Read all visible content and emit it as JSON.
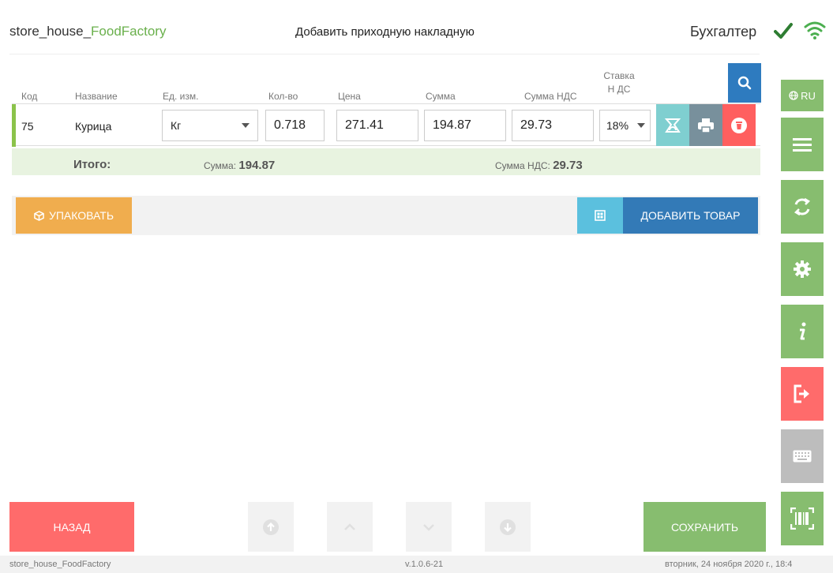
{
  "header": {
    "brand_prefix": "store_house_",
    "brand_accent": "FoodFactory",
    "title": "Добавить приходную накладную",
    "user": "Бухгалтер"
  },
  "table": {
    "columns": [
      "Код",
      "Название",
      "Ед. изм.",
      "Кол-во",
      "Цена",
      "Сумма",
      "Сумма НДС",
      "Ставка НДС"
    ],
    "vat_rate_header": "Ставка Н ДС",
    "rows": [
      {
        "code": "75",
        "name": "Курица",
        "unit": "Кг",
        "qty": "0.718",
        "price": "271.41",
        "sum": "194.87",
        "vat_sum": "29.73",
        "vat_rate": "18%"
      }
    ]
  },
  "totals": {
    "label": "Итого:",
    "sum_label": "Сумма:",
    "sum_value": "194.87",
    "vat_label": "Сумма НДС:",
    "vat_value": "29.73"
  },
  "actions": {
    "pack": "УПАКОВАТЬ",
    "add_item": "ДОБАВИТЬ ТОВАР"
  },
  "sidebar": {
    "lang": "RU",
    "items": [
      "menu-icon",
      "sync-icon",
      "gear-icon",
      "info-icon",
      "logout-icon",
      "keyboard-icon",
      "barcode-icon"
    ]
  },
  "footer": {
    "back": "НАЗАД",
    "save": "СОХРАНИТЬ"
  },
  "statusbar": {
    "app": "store_house_FoodFactory",
    "version": "v.1.0.6-21",
    "datetime": "вторник, 24 ноября 2020 г., 18:4"
  },
  "colors": {
    "green": "#87bd6f",
    "red": "#ff6b6b",
    "blue": "#337ab7",
    "cyan": "#5bc0de",
    "orange": "#f0ad4e"
  }
}
